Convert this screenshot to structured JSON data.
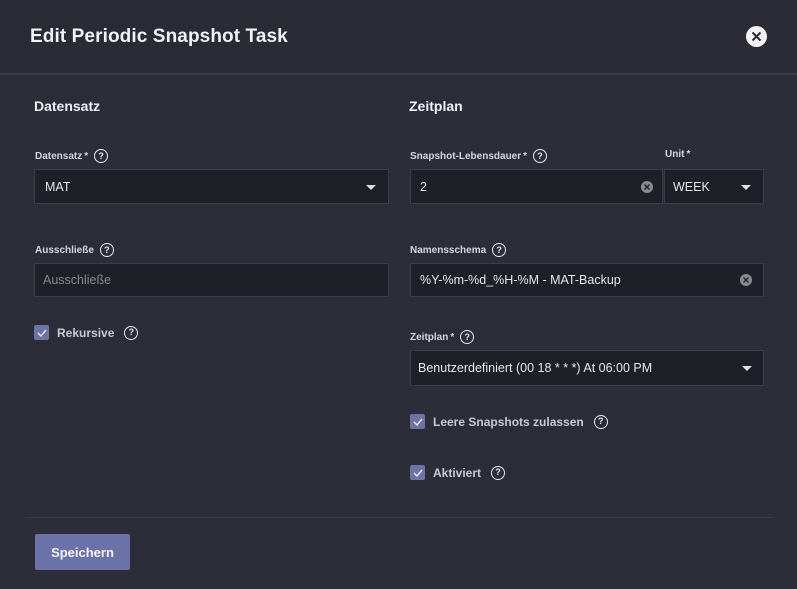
{
  "dialog": {
    "title": "Edit Periodic Snapshot Task"
  },
  "left": {
    "section_title": "Datensatz",
    "dataset": {
      "label": "Datensatz",
      "required": "*",
      "value": "MAT"
    },
    "exclude": {
      "label": "Ausschließe",
      "placeholder": "Ausschließe"
    },
    "recursive": {
      "label": "Rekursive",
      "checked": true
    }
  },
  "right": {
    "section_title": "Zeitplan",
    "lifetime": {
      "label": "Snapshot-Lebensdauer",
      "required": "*",
      "value": "2"
    },
    "unit": {
      "label": "Unit",
      "required": "*",
      "value": "WEEK"
    },
    "naming_schema": {
      "label": "Namensschema",
      "value": "%Y-%m-%d_%H-%M - MAT-Backup"
    },
    "schedule": {
      "label": "Zeitplan",
      "required": "*",
      "value": "Benutzerdefiniert (00 18 * * *) At 06:00 PM"
    },
    "allow_empty": {
      "label": "Leere Snapshots zulassen",
      "checked": true
    },
    "enabled": {
      "label": "Aktiviert",
      "checked": true
    }
  },
  "footer": {
    "save_label": "Speichern"
  },
  "icons": {
    "help": "help-circle-icon",
    "close": "close-icon",
    "clear": "clear-circle-icon",
    "dropdown": "chevron-down-icon",
    "check": "check-icon"
  },
  "colors": {
    "background": "#2c2d38",
    "input_background": "#1f1f28",
    "accent": "#6b72a8"
  }
}
